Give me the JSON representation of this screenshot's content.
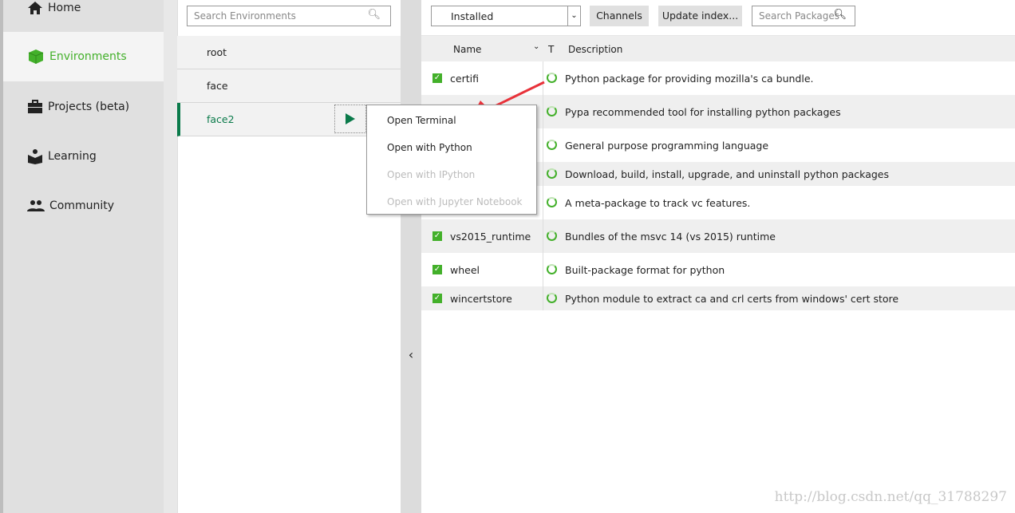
{
  "sidebar": {
    "items": [
      {
        "label": "Home",
        "icon": "home-icon"
      },
      {
        "label": "Environments",
        "icon": "cube-icon",
        "active": true
      },
      {
        "label": "Projects (beta)",
        "icon": "briefcase-icon"
      },
      {
        "label": "Learning",
        "icon": "book-reader-icon"
      },
      {
        "label": "Community",
        "icon": "people-icon"
      }
    ]
  },
  "environments": {
    "search_placeholder": "Search Environments",
    "items": [
      {
        "name": "root"
      },
      {
        "name": "face"
      },
      {
        "name": "face2",
        "selected": true
      }
    ]
  },
  "context_menu": {
    "items": [
      {
        "label": "Open Terminal",
        "enabled": true
      },
      {
        "label": "Open with Python",
        "enabled": true
      },
      {
        "label": "Open with IPython",
        "enabled": false
      },
      {
        "label": "Open with Jupyter Notebook",
        "enabled": false
      }
    ]
  },
  "packages": {
    "filter": "Installed",
    "channels_label": "Channels",
    "update_label": "Update index...",
    "search_placeholder": "Search Packages",
    "columns": {
      "name": "Name",
      "type": "T",
      "description": "Description"
    },
    "rows": [
      {
        "name": "certifi",
        "description": "Python package for providing mozilla's ca bundle."
      },
      {
        "name": "",
        "description": "Pypa recommended tool for installing python packages"
      },
      {
        "name": "",
        "description": "General purpose programming language"
      },
      {
        "name": "",
        "description": "Download, build, install, upgrade, and uninstall python packages"
      },
      {
        "name": "",
        "description": "A meta-package to track vc features."
      },
      {
        "name": "vs2015_runtime",
        "description": "Bundles of the msvc 14 (vs 2015) runtime"
      },
      {
        "name": "wheel",
        "description": "Built-package format for python"
      },
      {
        "name": "wincertstore",
        "description": "Python module to extract ca and crl certs from windows' cert store"
      }
    ]
  },
  "watermark": "http://blog.csdn.net/qq_31788297",
  "colors": {
    "accent": "#43b02a",
    "selected_env": "#0a7a4a",
    "annotation_arrow": "#e8323a"
  }
}
